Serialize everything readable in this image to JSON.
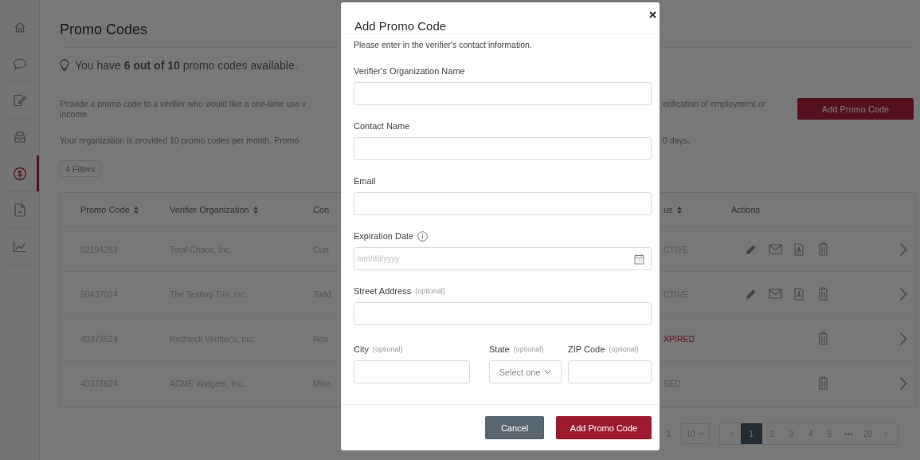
{
  "sidebar": {
    "items": [
      {
        "kind": "home",
        "selected": false
      },
      {
        "kind": "chat",
        "selected": false
      },
      {
        "kind": "edit",
        "selected": false
      },
      {
        "kind": "inbox",
        "selected": false
      },
      {
        "kind": "dollar",
        "selected": true
      },
      {
        "kind": "document",
        "selected": false
      },
      {
        "kind": "chart",
        "selected": false
      }
    ]
  },
  "page": {
    "title": "Promo Codes",
    "availability": "You have **6 out of 10** promo codes available.",
    "intro_left": [
      "Provide a promo code to a verifier who would like a one-time use v",
      "income."
    ],
    "intro_right": "erification of employment or",
    "add_button": "Add Promo Code",
    "limit_left": "Your organization is provided 10 promo codes per month. Promo",
    "limit_right": "0 days.",
    "filters": "4 Filters"
  },
  "table": {
    "columns": [
      {
        "label": "Promo Code",
        "sortable": true
      },
      {
        "label": "Verifier Organization",
        "sortable": true
      },
      {
        "label": "Con",
        "sortable": false
      },
      {
        "label": "us",
        "sortable": true
      },
      {
        "label": "Actions",
        "sortable": false
      }
    ],
    "rows": [
      {
        "code": "02194283",
        "organization": "Total Chaos, Inc.",
        "contact": "Curt",
        "status": "CTIVE",
        "kind": "active",
        "editable": true
      },
      {
        "code": "90437024",
        "organization": "The Testing Trio, Inc.",
        "contact": "Todd",
        "status": "CTIVE",
        "kind": "active",
        "editable": true
      },
      {
        "code": "40373624",
        "organization": "Redneck Verifier's, Inc.",
        "contact": "Ron",
        "status": "XPIRED",
        "kind": "expired",
        "editable": false
      },
      {
        "code": "40373624",
        "organization": "ACME Widgets, Inc.",
        "contact": "Mike",
        "status": "SED",
        "kind": "used",
        "editable": false
      }
    ]
  },
  "pagination": {
    "summary": "1",
    "page_size": "10",
    "pages": [
      {
        "label": "1",
        "selected": true
      },
      {
        "label": "2",
        "selected": false
      },
      {
        "label": "3",
        "selected": false
      },
      {
        "label": "4",
        "selected": false
      },
      {
        "label": "5",
        "selected": false
      },
      {
        "label": "•••",
        "selected": false
      },
      {
        "label": "20",
        "selected": false
      }
    ]
  },
  "modal": {
    "title": "Add Promo Code",
    "subtitle": "Please enter in the verifier's contact information.",
    "fields": [
      {
        "kind": "text",
        "label": "Verifier's Organization Name",
        "info": false
      },
      {
        "kind": "text",
        "label": "Contact Name",
        "info": false
      },
      {
        "kind": "text",
        "label": "Email",
        "info": false
      },
      {
        "kind": "date",
        "label": "Expiration Date",
        "placeholder": "mm/dd/yyyy",
        "info": true
      },
      {
        "kind": "text",
        "label": "Street Address",
        "hint": "(optional)",
        "info": false
      }
    ],
    "address_fields": [
      {
        "kind": "text",
        "label": "City",
        "hint": "(optional)"
      },
      {
        "kind": "select",
        "label": "State",
        "hint": "(optional)",
        "value": "Select one"
      },
      {
        "kind": "text",
        "label": "ZIP Code",
        "hint": "(optional)"
      }
    ],
    "buttons": [
      {
        "kind": "secondary",
        "label": "Cancel"
      },
      {
        "kind": "primary",
        "label": "Add Promo Code"
      }
    ]
  }
}
